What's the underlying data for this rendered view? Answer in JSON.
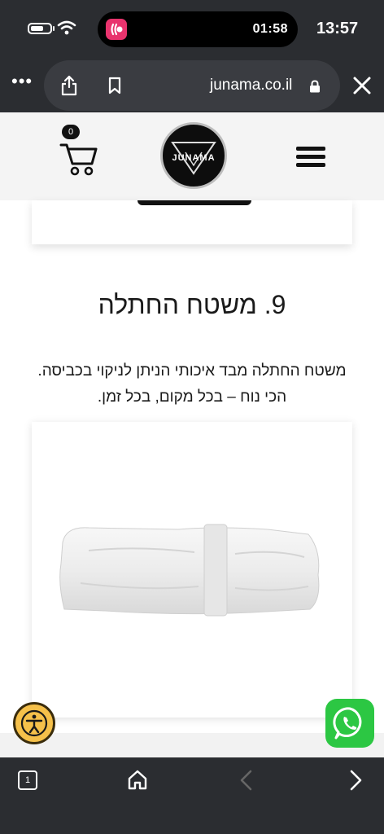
{
  "status": {
    "clock": "13:57",
    "island_time": "01:58"
  },
  "browser": {
    "url": "junama.co.il"
  },
  "header": {
    "cart_count": "0",
    "logo_text": "JUNAMA"
  },
  "section": {
    "title": "9. משטח החתלה",
    "desc_line1": "משטח החתלה מבד איכותי הניתן לניקוי בכביסה.",
    "desc_line2": "הכי נוח – בכל מקום, בכל זמן."
  },
  "toolbar": {
    "tabs_count": "1"
  },
  "colors": {
    "whatsapp": "#2cc743",
    "accessibility": "#f5c04a",
    "chrome": "#2b2d31"
  }
}
